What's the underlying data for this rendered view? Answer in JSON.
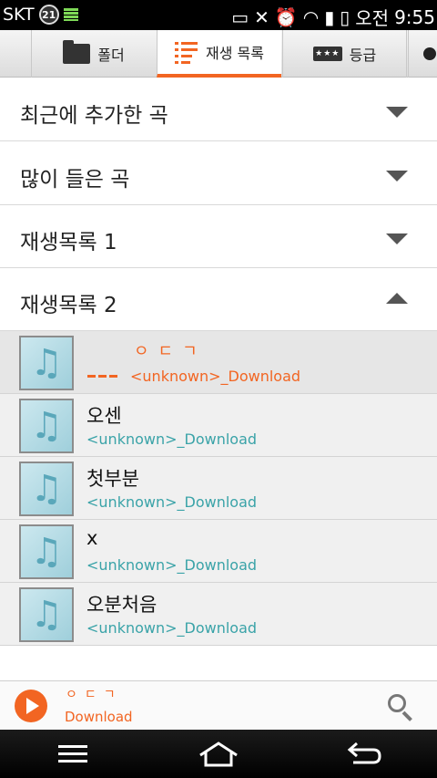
{
  "status_bar": {
    "carrier": "SKT",
    "badge": "21",
    "ampm": "오전",
    "time": "9:55"
  },
  "tabs": [
    {
      "label": "폴더",
      "icon": "folder-icon",
      "active": false
    },
    {
      "label": "재생 목록",
      "icon": "playlist-icon",
      "active": true
    },
    {
      "label": "등급",
      "icon": "rating-icon",
      "active": false
    }
  ],
  "sections": [
    {
      "label": "최근에 추가한 곡",
      "expanded": false
    },
    {
      "label": "많이 들은 곡",
      "expanded": false
    },
    {
      "label": "재생목록 1",
      "expanded": false
    },
    {
      "label": "재생목록 2",
      "expanded": true
    }
  ],
  "songs": [
    {
      "title": "ㅇㄷㄱ",
      "subtitle": "<unknown>_Download",
      "now_playing": true
    },
    {
      "title": "오센",
      "subtitle": "<unknown>_Download",
      "now_playing": false
    },
    {
      "title": "첫부분",
      "subtitle": "<unknown>_Download",
      "now_playing": false
    },
    {
      "title": "x",
      "subtitle": "<unknown>_Download",
      "now_playing": false
    },
    {
      "title": "오분처음",
      "subtitle": "<unknown>_Download",
      "now_playing": false
    }
  ],
  "mini_player": {
    "title": "ㅇㄷㄱ",
    "subtitle": "Download"
  },
  "colors": {
    "accent": "#f26522",
    "subtitle": "#3aa3a8"
  }
}
